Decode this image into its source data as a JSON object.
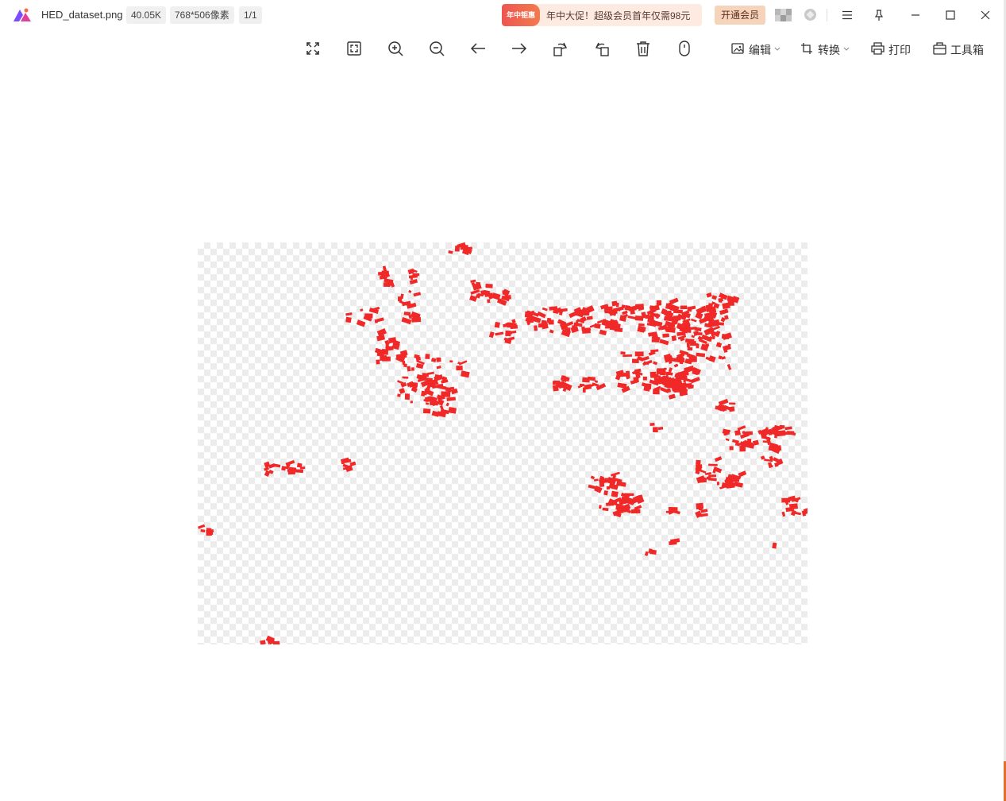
{
  "titlebar": {
    "filename": "HED_dataset.png",
    "filesize": "40.05K",
    "dimensions": "768*506像素",
    "page_index": "1/1",
    "promo": {
      "badge_text": "年中钜惠",
      "text": "年中大促！超级会员首年仅需98元"
    },
    "vip_button": "开通会员"
  },
  "toolbar": {
    "edit_label": "编辑",
    "convert_label": "转换",
    "print_label": "打印",
    "toolbox_label": "工具箱"
  },
  "colors": {
    "mask_red": "#f02828",
    "accent_orange": "#f27a4e",
    "checker": "#ececec"
  }
}
